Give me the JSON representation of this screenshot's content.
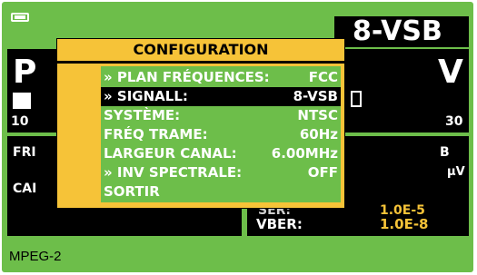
{
  "status": {
    "battery_icon": "battery-icon",
    "modulation": "8-VSB",
    "label_ber": "VBER:",
    "vber": "1.0E-8",
    "ser_partial": "SER:",
    "ser_value_partial": "1.0E-5",
    "footer": "MPEG-2",
    "fragments": {
      "big_p": "P",
      "big_v": "V",
      "num_left": "10",
      "num_right": "30",
      "fr": "FRI",
      "ca": "CAI",
      "uv": "µV",
      "b": "B"
    }
  },
  "popup": {
    "title": "CONFIGURATION",
    "items": [
      {
        "label": "» PLAN FRÉQUENCES:",
        "value": "FCC"
      },
      {
        "label": "» SIGNALL:",
        "value": "8-VSB"
      },
      {
        "label": "SYSTÈME:",
        "value": "NTSC"
      },
      {
        "label": "FRÉQ TRAME:",
        "value": "60Hz"
      },
      {
        "label": "LARGEUR CANAL:",
        "value": "6.00MHz"
      },
      {
        "label": "» INV SPECTRALE:",
        "value": "OFF"
      },
      {
        "label": "SORTIR",
        "value": ""
      }
    ],
    "selected_index": 1
  },
  "colors": {
    "screen_bg": "#6dbe4a",
    "panel_bg": "#000000",
    "popup_bg": "#f6c338",
    "accent_yellow": "#f6c338",
    "text_white": "#ffffff"
  }
}
